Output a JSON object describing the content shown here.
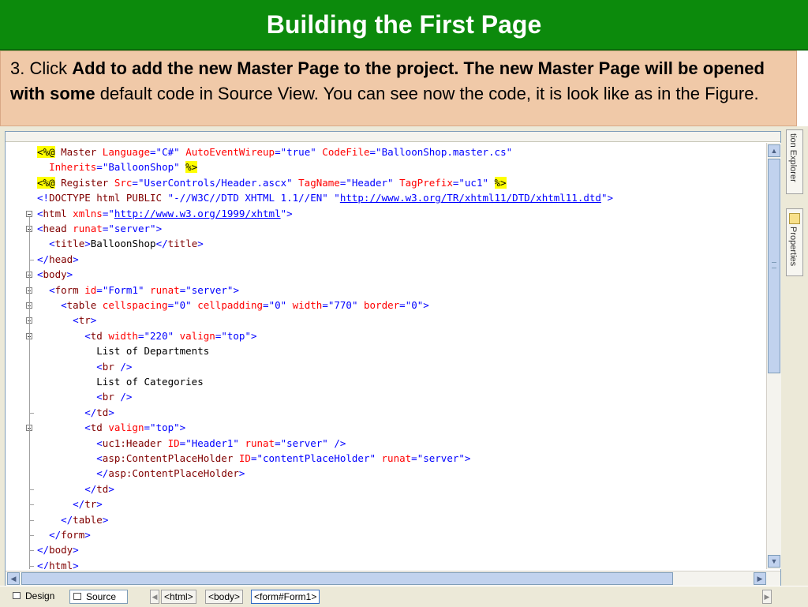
{
  "slide": {
    "title": "Building the First Page"
  },
  "instruction": {
    "prefix": "3. Click ",
    "bold": "Add to add the new Master Page to the project. The new Master Page will be opened with some",
    "suffix": " default code in Source View. You can see now the code, it is look like as in the Figure."
  },
  "editor": {
    "lines": [
      [
        {
          "c": "dir",
          "t": "<%@"
        },
        {
          "c": "tag",
          "t": " Master "
        },
        {
          "c": "attr",
          "t": "Language"
        },
        {
          "c": "punct",
          "t": "="
        },
        {
          "c": "val",
          "t": "\"C#\" "
        },
        {
          "c": "attr",
          "t": "AutoEventWireup"
        },
        {
          "c": "punct",
          "t": "="
        },
        {
          "c": "val",
          "t": "\"true\" "
        },
        {
          "c": "attr",
          "t": "CodeFile"
        },
        {
          "c": "punct",
          "t": "="
        },
        {
          "c": "val",
          "t": "\"BalloonShop.master.cs\""
        }
      ],
      [
        {
          "c": "txt",
          "t": "  "
        },
        {
          "c": "attr",
          "t": "Inherits"
        },
        {
          "c": "punct",
          "t": "="
        },
        {
          "c": "val",
          "t": "\"BalloonShop\" "
        },
        {
          "c": "dir",
          "t": "%>"
        }
      ],
      [
        {
          "c": "dir",
          "t": "<%@"
        },
        {
          "c": "tag",
          "t": " Register "
        },
        {
          "c": "attr",
          "t": "Src"
        },
        {
          "c": "punct",
          "t": "="
        },
        {
          "c": "val",
          "t": "\"UserControls/Header.ascx\" "
        },
        {
          "c": "attr",
          "t": "TagName"
        },
        {
          "c": "punct",
          "t": "="
        },
        {
          "c": "val",
          "t": "\"Header\" "
        },
        {
          "c": "attr",
          "t": "TagPrefix"
        },
        {
          "c": "punct",
          "t": "="
        },
        {
          "c": "val",
          "t": "\"uc1\" "
        },
        {
          "c": "dir",
          "t": "%>"
        }
      ],
      [
        {
          "c": "punct",
          "t": "<!"
        },
        {
          "c": "tag",
          "t": "DOCTYPE html PUBLIC "
        },
        {
          "c": "val",
          "t": "\"-//W3C//DTD XHTML 1.1//EN\" \""
        },
        {
          "c": "link",
          "t": "http://www.w3.org/TR/xhtml11/DTD/xhtml11.dtd"
        },
        {
          "c": "val",
          "t": "\""
        },
        {
          "c": "punct",
          "t": ">"
        }
      ],
      [
        {
          "c": "punct",
          "t": "<"
        },
        {
          "c": "tag",
          "t": "html "
        },
        {
          "c": "attr",
          "t": "xmlns"
        },
        {
          "c": "punct",
          "t": "="
        },
        {
          "c": "val",
          "t": "\""
        },
        {
          "c": "link",
          "t": "http://www.w3.org/1999/xhtml"
        },
        {
          "c": "val",
          "t": "\""
        },
        {
          "c": "punct",
          "t": ">"
        }
      ],
      [
        {
          "c": "punct",
          "t": "<"
        },
        {
          "c": "tag",
          "t": "head "
        },
        {
          "c": "attr",
          "t": "runat"
        },
        {
          "c": "punct",
          "t": "="
        },
        {
          "c": "val",
          "t": "\"server\""
        },
        {
          "c": "punct",
          "t": ">"
        }
      ],
      [
        {
          "c": "txt",
          "t": "  "
        },
        {
          "c": "punct",
          "t": "<"
        },
        {
          "c": "tag",
          "t": "title"
        },
        {
          "c": "punct",
          "t": ">"
        },
        {
          "c": "txt",
          "t": "BalloonShop"
        },
        {
          "c": "punct",
          "t": "</"
        },
        {
          "c": "tag",
          "t": "title"
        },
        {
          "c": "punct",
          "t": ">"
        }
      ],
      [
        {
          "c": "punct",
          "t": "</"
        },
        {
          "c": "tag",
          "t": "head"
        },
        {
          "c": "punct",
          "t": ">"
        }
      ],
      [
        {
          "c": "punct",
          "t": "<"
        },
        {
          "c": "tag",
          "t": "body"
        },
        {
          "c": "punct",
          "t": ">"
        }
      ],
      [
        {
          "c": "txt",
          "t": "  "
        },
        {
          "c": "punct",
          "t": "<"
        },
        {
          "c": "tag",
          "t": "form "
        },
        {
          "c": "attr",
          "t": "id"
        },
        {
          "c": "punct",
          "t": "="
        },
        {
          "c": "val",
          "t": "\"Form1\" "
        },
        {
          "c": "attr",
          "t": "runat"
        },
        {
          "c": "punct",
          "t": "="
        },
        {
          "c": "val",
          "t": "\"server\""
        },
        {
          "c": "punct",
          "t": ">"
        }
      ],
      [
        {
          "c": "txt",
          "t": "    "
        },
        {
          "c": "punct",
          "t": "<"
        },
        {
          "c": "tag",
          "t": "table "
        },
        {
          "c": "attr",
          "t": "cellspacing"
        },
        {
          "c": "punct",
          "t": "="
        },
        {
          "c": "val",
          "t": "\"0\" "
        },
        {
          "c": "attr",
          "t": "cellpadding"
        },
        {
          "c": "punct",
          "t": "="
        },
        {
          "c": "val",
          "t": "\"0\" "
        },
        {
          "c": "attr",
          "t": "width"
        },
        {
          "c": "punct",
          "t": "="
        },
        {
          "c": "val",
          "t": "\"770\" "
        },
        {
          "c": "attr",
          "t": "border"
        },
        {
          "c": "punct",
          "t": "="
        },
        {
          "c": "val",
          "t": "\"0\""
        },
        {
          "c": "punct",
          "t": ">"
        }
      ],
      [
        {
          "c": "txt",
          "t": "      "
        },
        {
          "c": "punct",
          "t": "<"
        },
        {
          "c": "tag",
          "t": "tr"
        },
        {
          "c": "punct",
          "t": ">"
        }
      ],
      [
        {
          "c": "txt",
          "t": "        "
        },
        {
          "c": "punct",
          "t": "<"
        },
        {
          "c": "tag",
          "t": "td "
        },
        {
          "c": "attr",
          "t": "width"
        },
        {
          "c": "punct",
          "t": "="
        },
        {
          "c": "val",
          "t": "\"220\" "
        },
        {
          "c": "attr",
          "t": "valign"
        },
        {
          "c": "punct",
          "t": "="
        },
        {
          "c": "val",
          "t": "\"top\""
        },
        {
          "c": "punct",
          "t": ">"
        }
      ],
      [
        {
          "c": "txt",
          "t": "          List of Departments"
        }
      ],
      [
        {
          "c": "txt",
          "t": "          "
        },
        {
          "c": "punct",
          "t": "<"
        },
        {
          "c": "tag",
          "t": "br "
        },
        {
          "c": "punct",
          "t": "/>"
        }
      ],
      [
        {
          "c": "txt",
          "t": "          List of Categories"
        }
      ],
      [
        {
          "c": "txt",
          "t": "          "
        },
        {
          "c": "punct",
          "t": "<"
        },
        {
          "c": "tag",
          "t": "br "
        },
        {
          "c": "punct",
          "t": "/>"
        }
      ],
      [
        {
          "c": "txt",
          "t": "        "
        },
        {
          "c": "punct",
          "t": "</"
        },
        {
          "c": "tag",
          "t": "td"
        },
        {
          "c": "punct",
          "t": ">"
        }
      ],
      [
        {
          "c": "txt",
          "t": "        "
        },
        {
          "c": "punct",
          "t": "<"
        },
        {
          "c": "tag",
          "t": "td "
        },
        {
          "c": "attr",
          "t": "valign"
        },
        {
          "c": "punct",
          "t": "="
        },
        {
          "c": "val",
          "t": "\"top\""
        },
        {
          "c": "punct",
          "t": ">"
        }
      ],
      [
        {
          "c": "txt",
          "t": "          "
        },
        {
          "c": "punct",
          "t": "<"
        },
        {
          "c": "tag",
          "t": "uc1:Header "
        },
        {
          "c": "attr",
          "t": "ID"
        },
        {
          "c": "punct",
          "t": "="
        },
        {
          "c": "val",
          "t": "\"Header1\" "
        },
        {
          "c": "attr",
          "t": "runat"
        },
        {
          "c": "punct",
          "t": "="
        },
        {
          "c": "val",
          "t": "\"server\" "
        },
        {
          "c": "punct",
          "t": "/>"
        }
      ],
      [
        {
          "c": "txt",
          "t": "          "
        },
        {
          "c": "punct",
          "t": "<"
        },
        {
          "c": "tag",
          "t": "asp:ContentPlaceHolder "
        },
        {
          "c": "attr",
          "t": "ID"
        },
        {
          "c": "punct",
          "t": "="
        },
        {
          "c": "val",
          "t": "\"contentPlaceHolder\" "
        },
        {
          "c": "attr",
          "t": "runat"
        },
        {
          "c": "punct",
          "t": "="
        },
        {
          "c": "val",
          "t": "\"server\""
        },
        {
          "c": "punct",
          "t": ">"
        }
      ],
      [
        {
          "c": "txt",
          "t": "          "
        },
        {
          "c": "punct",
          "t": "</"
        },
        {
          "c": "tag",
          "t": "asp:ContentPlaceHolder"
        },
        {
          "c": "punct",
          "t": ">"
        }
      ],
      [
        {
          "c": "txt",
          "t": "        "
        },
        {
          "c": "punct",
          "t": "</"
        },
        {
          "c": "tag",
          "t": "td"
        },
        {
          "c": "punct",
          "t": ">"
        }
      ],
      [
        {
          "c": "txt",
          "t": "      "
        },
        {
          "c": "punct",
          "t": "</"
        },
        {
          "c": "tag",
          "t": "tr"
        },
        {
          "c": "punct",
          "t": ">"
        }
      ],
      [
        {
          "c": "txt",
          "t": "    "
        },
        {
          "c": "punct",
          "t": "</"
        },
        {
          "c": "tag",
          "t": "table"
        },
        {
          "c": "punct",
          "t": ">"
        }
      ],
      [
        {
          "c": "txt",
          "t": "  "
        },
        {
          "c": "punct",
          "t": "</"
        },
        {
          "c": "tag",
          "t": "form"
        },
        {
          "c": "punct",
          "t": ">"
        }
      ],
      [
        {
          "c": "punct",
          "t": "</"
        },
        {
          "c": "tag",
          "t": "body"
        },
        {
          "c": "punct",
          "t": ">"
        }
      ],
      [
        {
          "c": "punct",
          "t": "</"
        },
        {
          "c": "tag",
          "t": "html"
        },
        {
          "c": "punct",
          "t": ">"
        }
      ]
    ]
  },
  "side_panels": {
    "solution_explorer": "tion Explorer",
    "properties": "Properties"
  },
  "bottom_bar": {
    "design_label": "Design",
    "source_label": "Source",
    "breadcrumbs": [
      "<html>",
      "<body>",
      "<form#Form1>"
    ]
  },
  "colors": {
    "title_bg": "#0c8a0c",
    "instruction_bg": "#f0c9a8",
    "tag": "#800000",
    "attribute": "#ff0000",
    "value": "#0000ff",
    "directive_highlight": "#ffff00"
  }
}
